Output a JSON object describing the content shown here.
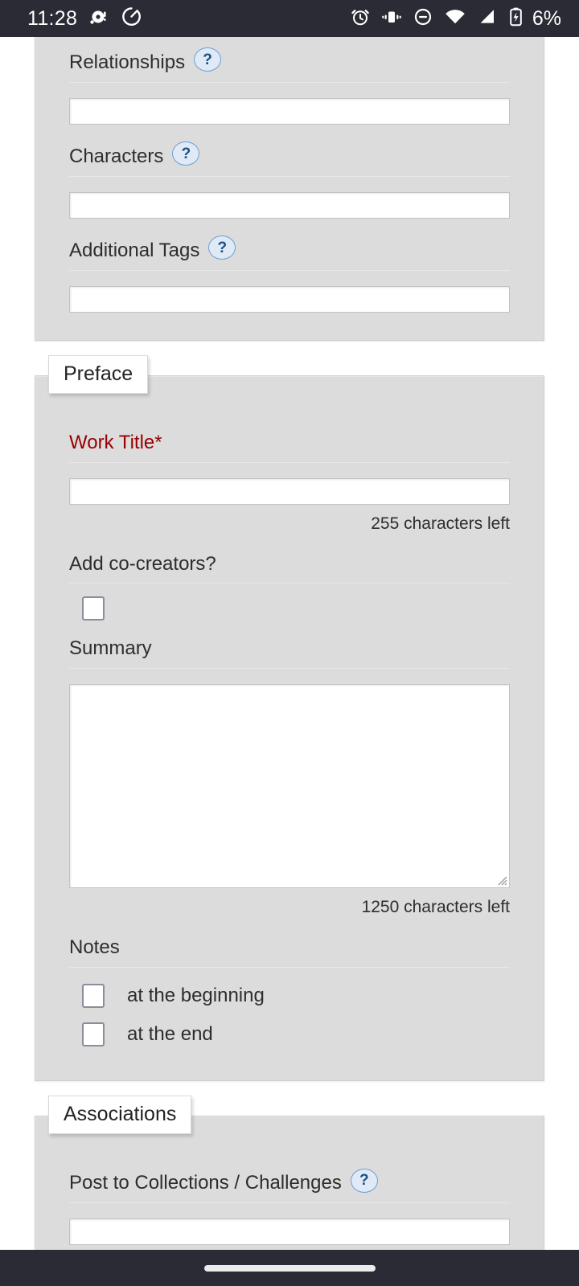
{
  "status_bar": {
    "time": "11:28",
    "battery_percent": "6%",
    "left_icons": [
      "notification-dot-icon",
      "data-saver-icon"
    ],
    "right_icons": [
      "alarm-icon",
      "vibrate-icon",
      "do-not-disturb-icon",
      "wifi-icon",
      "cellular-signal-icon",
      "battery-charging-icon"
    ],
    "background_color": "#2b2b35"
  },
  "colors": {
    "fieldset_bg": "#dcdcdc",
    "page_bg": "#ffffff",
    "required_label": "#990000",
    "help_bubble_fill": "#dfeaf6",
    "help_bubble_border": "#6f9ed4",
    "checkbox_border": "#8c8c9c"
  },
  "tags_fieldset": {
    "fields": [
      {
        "label": "Relationships",
        "help": "?",
        "value": "",
        "placeholder": ""
      },
      {
        "label": "Characters",
        "help": "?",
        "value": "",
        "placeholder": ""
      },
      {
        "label": "Additional Tags",
        "help": "?",
        "value": "",
        "placeholder": ""
      }
    ]
  },
  "preface_fieldset": {
    "legend": "Preface",
    "work_title": {
      "label": "Work Title*",
      "value": "",
      "placeholder": "",
      "char_count": "255 characters left"
    },
    "co_creators": {
      "label": "Add co-creators?",
      "checked": false
    },
    "summary": {
      "label": "Summary",
      "value": "",
      "placeholder": "",
      "char_count": "1250 characters left"
    },
    "notes": {
      "label": "Notes",
      "options": [
        {
          "label": "at the beginning",
          "checked": false
        },
        {
          "label": "at the end",
          "checked": false
        }
      ]
    }
  },
  "associations_fieldset": {
    "legend": "Associations",
    "collections": {
      "label": "Post to Collections / Challenges",
      "help": "?",
      "value": "",
      "placeholder": ""
    }
  },
  "nav_bar": {
    "home_indicator": "home-gesture-pill"
  }
}
